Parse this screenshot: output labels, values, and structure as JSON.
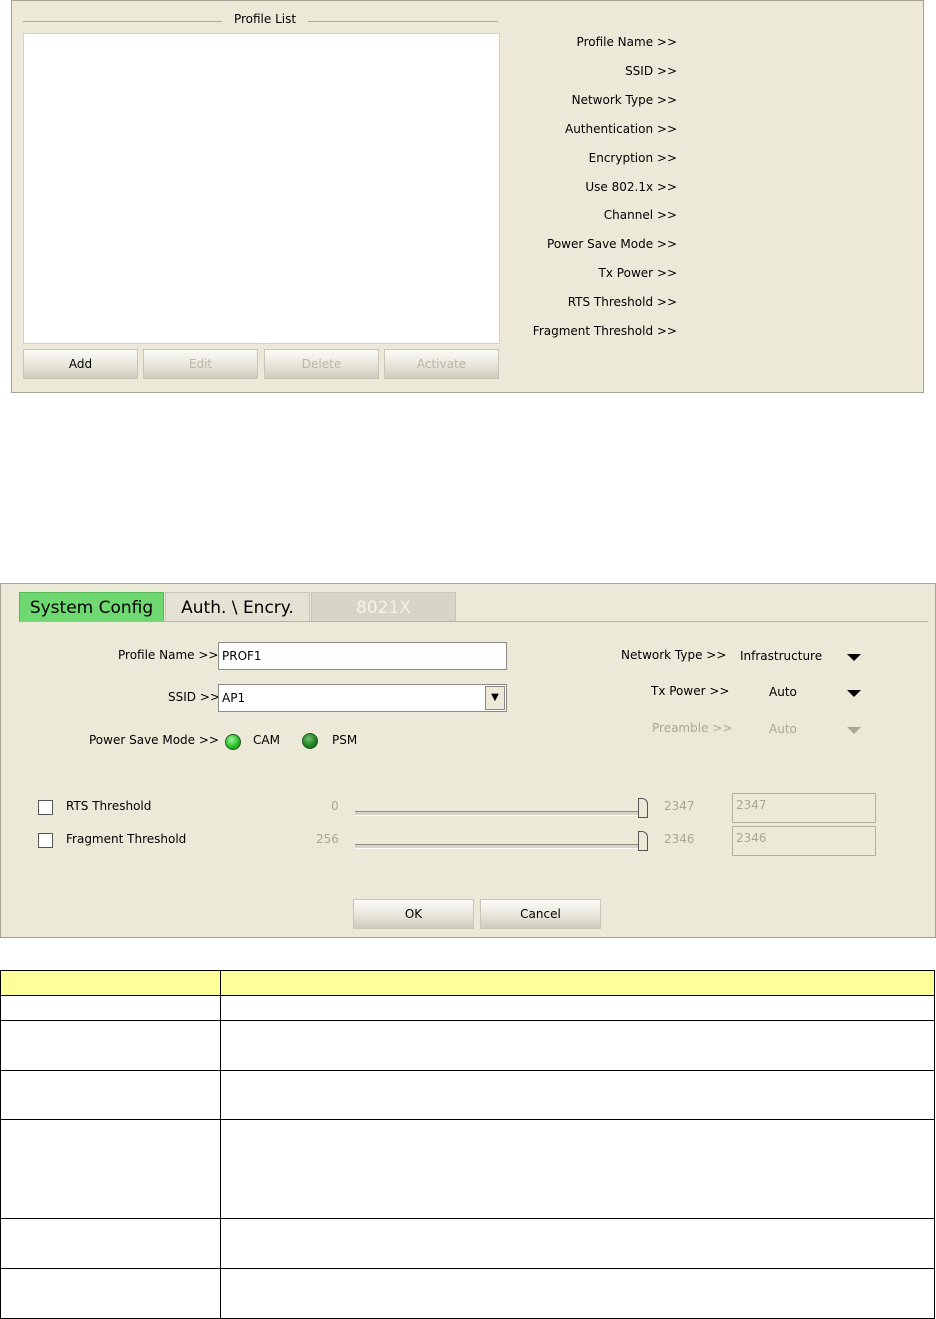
{
  "profile_panel": {
    "group_title": "Profile List",
    "buttons": {
      "add": "Add",
      "edit": "Edit",
      "delete": "Delete",
      "activate": "Activate"
    },
    "details": [
      "Profile Name >>",
      "SSID >>",
      "Network Type >>",
      "Authentication >>",
      "Encryption >>",
      "Use 802.1x >>",
      "Channel >>",
      "Power Save Mode >>",
      "Tx Power >>",
      "RTS Threshold >>",
      "Fragment Threshold >>"
    ]
  },
  "config_panel": {
    "tabs": [
      "System Config",
      "Auth. \\ Encry.",
      "8021X"
    ],
    "profile_name_label": "Profile Name >>",
    "profile_name_value": "PROF1",
    "ssid_label": "SSID >>",
    "ssid_value": "AP1",
    "power_save_label": "Power Save Mode >>",
    "power_save_options": [
      "CAM",
      "PSM"
    ],
    "network_type_label": "Network Type >>",
    "network_type_value": "Infrastructure",
    "tx_power_label": "Tx Power >>",
    "tx_power_value": "Auto",
    "preamble_label": "Preamble >>",
    "preamble_value": "Auto",
    "rts": {
      "label": "RTS Threshold",
      "min": "0",
      "max": "2347",
      "value": "2347"
    },
    "fragment": {
      "label": "Fragment Threshold",
      "min": "256",
      "max": "2346",
      "value": "2346"
    },
    "buttons": {
      "ok": "OK",
      "cancel": "Cancel"
    }
  },
  "colors": {
    "panel_bg": "#ece9d8",
    "active_tab": "#6fd870",
    "table_header": "#ffff99",
    "radio_green": "#22bb22"
  }
}
